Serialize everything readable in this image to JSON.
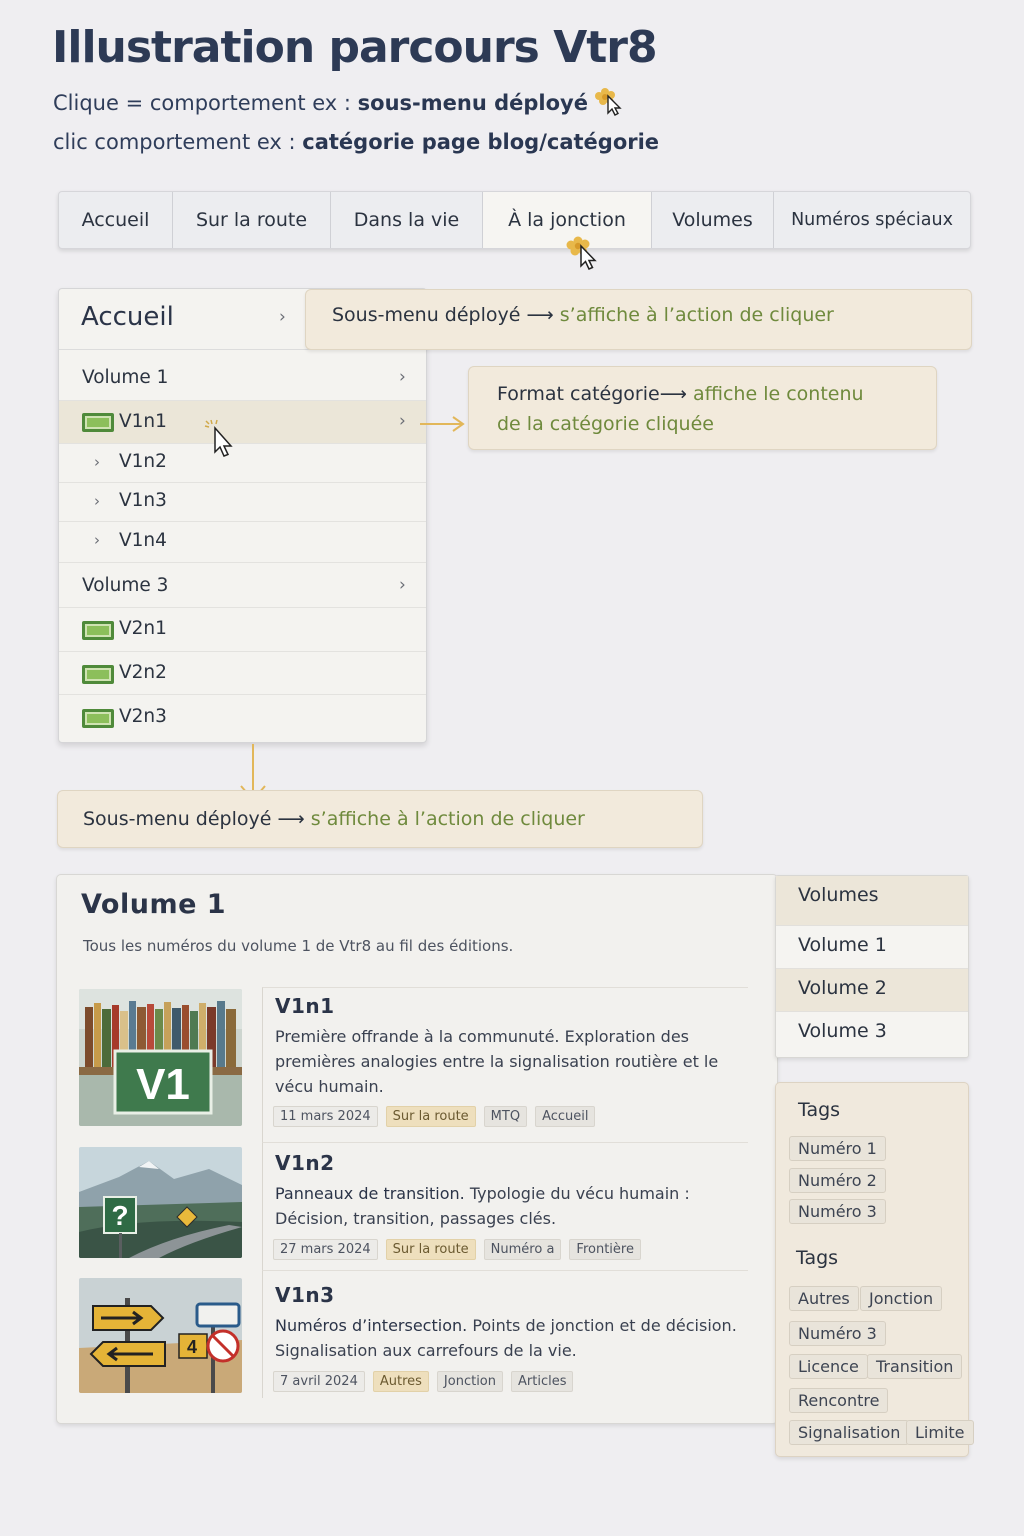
{
  "header": {
    "title": "Illustration parcours Vtr8",
    "line1_prefix": "Clique = comportement ex :",
    "line1_bold": "sous-menu déployé",
    "line2_prefix": "clic comportement ex :",
    "line2_bold": "catégorie page blog/catégorie"
  },
  "nav": {
    "items": [
      {
        "label": "Accueil"
      },
      {
        "label": "Sur la route"
      },
      {
        "label": "Dans la vie"
      },
      {
        "label": "À la jonction"
      },
      {
        "label": "Volumes"
      },
      {
        "label": "Numéros spéciaux"
      }
    ],
    "active_index": 3
  },
  "dropdown": {
    "head": "Accueil",
    "rows": [
      {
        "label": "Volume 1"
      },
      {
        "label": "V1n1"
      },
      {
        "label": "V1n2"
      },
      {
        "label": "V1n3"
      },
      {
        "label": "V1n4"
      },
      {
        "label": "Volume 3"
      },
      {
        "label": "V2n1"
      },
      {
        "label": "V2n2"
      },
      {
        "label": "V2n3"
      }
    ]
  },
  "callouts": {
    "c1": {
      "label": "Sous-menu déployé",
      "green": "s’affiche à l’action de cliquer"
    },
    "c2": {
      "label": "Format catégorie",
      "green1": "affiche le contenu",
      "green2": "de la catégorie cliquée"
    },
    "c3": {
      "label": "Sous-menu déployé",
      "green": "s’affiche à l’action de cliquer"
    }
  },
  "volume": {
    "title": "Volume 1",
    "description": "Tous les numéros du volume 1 de Vtr8 au fil des éditions.",
    "articles": [
      {
        "title": "V1n1",
        "text": "Première offrande à la communuté.  Exploration des premières analogies entre la signalisation routière et le vécu humain.",
        "date": "11 mars 2024",
        "tags": [
          "Sur la route",
          "MTQ",
          "Accueil"
        ],
        "thumb_label": "V1"
      },
      {
        "title": "V1n2",
        "lead": "Panneaux de transition.",
        "text": "Typologie du vécu humain : Décision, transition, passages clés.",
        "date": "27 mars 2024",
        "tags": [
          "Sur la route",
          "Numéro a",
          "Frontière"
        ],
        "thumb_label": "?"
      },
      {
        "title": "V1n3",
        "lead": "Numéros d’intersection.",
        "text": "Points de jonction et de décision. Signalisation aux carrefours de la vie.",
        "date": "7 avril 2024",
        "tags": [
          "Autres",
          "Jonction",
          "Articles"
        ],
        "thumb_label": "4"
      }
    ]
  },
  "sidebar": {
    "volumes": [
      "Volumes",
      "Volume 1",
      "Volume 2",
      "Volume 3"
    ],
    "tags_heading_1": "Tags",
    "tags_1": [
      "Numéro 1",
      "Numéro 2",
      "Numéro 3"
    ],
    "tags_heading_2": "Tags",
    "tags_2": [
      "Autres",
      "Jonction",
      "Numéro 3",
      "Licence",
      "Transition",
      "Rencontre",
      "Signalisation",
      "Limite"
    ]
  },
  "colors": {
    "accent_gold": "#e8b84a",
    "accent_green": "#6f8a3d",
    "title_navy": "#2d3a55"
  }
}
